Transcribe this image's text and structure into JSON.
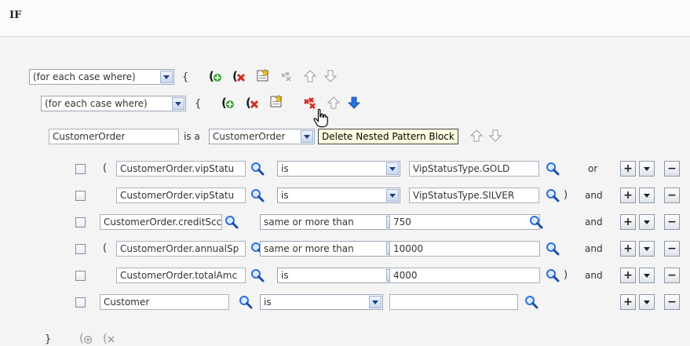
{
  "header": {
    "title": "IF"
  },
  "outer_block": {
    "mode": "(for each case where)",
    "open_brace": "{",
    "close_brace": "}"
  },
  "inner_block": {
    "mode": "(for each case where)",
    "open_brace": "{"
  },
  "pattern": {
    "variable": "CustomerOrder",
    "is_a_label": "is a",
    "type": "CustomerOrder"
  },
  "tooltip": {
    "text": "Delete Nested Pattern Block"
  },
  "conditions": [
    {
      "open_paren": "(",
      "field": "CustomerOrder.vipStatu",
      "operator": "is",
      "value": "VipStatusType.GOLD",
      "close_paren": "",
      "conjunction": "or"
    },
    {
      "open_paren": "",
      "field": "CustomerOrder.vipStatu",
      "operator": "is",
      "value": "VipStatusType.SILVER",
      "close_paren": ")",
      "conjunction": "and"
    },
    {
      "open_paren": "",
      "field": "CustomerOrder.creditScc",
      "operator": "same or more than",
      "value": "750",
      "close_paren": "",
      "conjunction": "and"
    },
    {
      "open_paren": "(",
      "field": "CustomerOrder.annualSp",
      "operator": "same or more than",
      "value": "10000",
      "close_paren": "",
      "conjunction": "and"
    },
    {
      "open_paren": "",
      "field": "CustomerOrder.totalAmc",
      "operator": "is",
      "value": "4000",
      "close_paren": ")",
      "conjunction": "and"
    },
    {
      "open_paren": "",
      "field": "Customer",
      "operator": "is",
      "value": "",
      "close_paren": "",
      "conjunction": ""
    }
  ],
  "row_buttons": {
    "add": "+",
    "remove": "−"
  },
  "icons": {
    "insert_pattern": "add-parenthesis-icon",
    "delete_pattern": "delete-parenthesis-icon",
    "new_nested": "new-nested-block-icon",
    "delete_nested": "delete-nested-block-icon",
    "move_up": "arrow-up-icon",
    "move_down": "arrow-down-icon",
    "search": "magnifier-icon"
  },
  "colors": {
    "accent_blue": "#2a6fdb",
    "add_green": "#2e9d2a",
    "delete_red": "#d32a1c",
    "tooltip_bg": "#ffffe1"
  }
}
